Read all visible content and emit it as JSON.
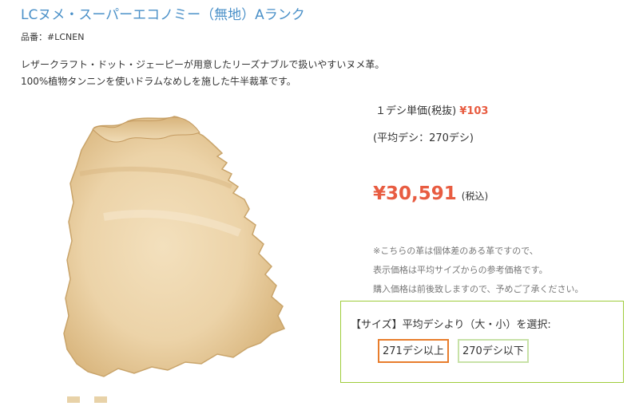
{
  "product": {
    "title": "LCヌメ・スーパーエコノミー（無地）Aランク",
    "sku": "品番：#LCNEN",
    "description": [
      "レザークラフト・ドット・ジェーピーが用意したリーズナブルで扱いやすいヌメ革。",
      "100%植物タンニンを使いドラムなめしを施した牛半裁革です。"
    ]
  },
  "pricing": {
    "unit_label": "１デシ単価(税抜)",
    "unit_price": "¥103",
    "average": "(平均デシ：270デシ)",
    "total_price": "¥30,591",
    "tax_note": "(税込)",
    "notes": [
      "※こちらの革は個体差のある革ですので、",
      "表示価格は平均サイズからの参考価格です。",
      "購入価格は前後致しますので、予めご了承ください。"
    ]
  },
  "size_selector": {
    "label": "【サイズ】平均デシより（大・小）を選択:",
    "options": [
      "271デシ以上",
      "270デシ以下"
    ],
    "selected": "271デシ以上"
  },
  "colors": {
    "title_blue": "#4a90c8",
    "price_red": "#e85c41",
    "box_border_green": "#9fcc3b",
    "selected_border_orange": "#e87d2c",
    "unselected_border_green": "#c8e2a8",
    "leather_tan": "#edd5ad"
  },
  "icons": {
    "product_image": "leather-hide-image"
  }
}
